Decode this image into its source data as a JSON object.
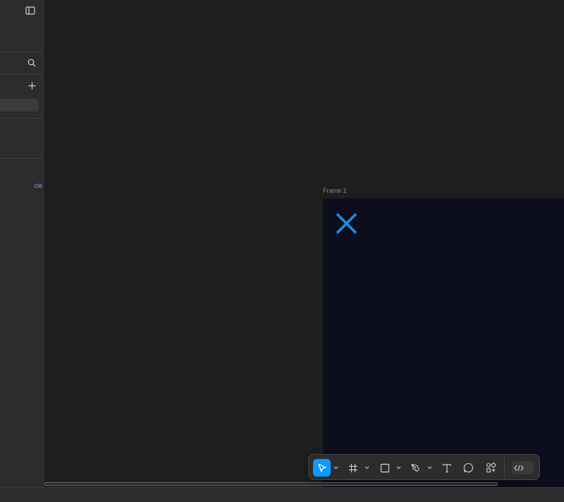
{
  "sidebar": {
    "layers": [
      {
        "label": "cle"
      }
    ]
  },
  "canvas": {
    "frame": {
      "label": "Frame 1"
    }
  },
  "colors": {
    "accent": "#0d99ff",
    "frame_fill": "#0d0e1d",
    "layer_text": "#9e8bff",
    "x_icon": "#1f8be6"
  },
  "toolbar": {
    "tools": [
      {
        "name": "move",
        "icon": "cursor-arrow-icon",
        "active": true
      },
      {
        "name": "frame",
        "icon": "frame-hash-icon"
      },
      {
        "name": "shape",
        "icon": "rectangle-icon"
      },
      {
        "name": "pen",
        "icon": "pen-nib-icon"
      },
      {
        "name": "text",
        "icon": "text-t-icon"
      },
      {
        "name": "comment",
        "icon": "comment-bubble-icon"
      },
      {
        "name": "actions",
        "icon": "components-icon"
      },
      {
        "name": "dev-mode",
        "icon": "code-brackets-icon"
      }
    ]
  }
}
